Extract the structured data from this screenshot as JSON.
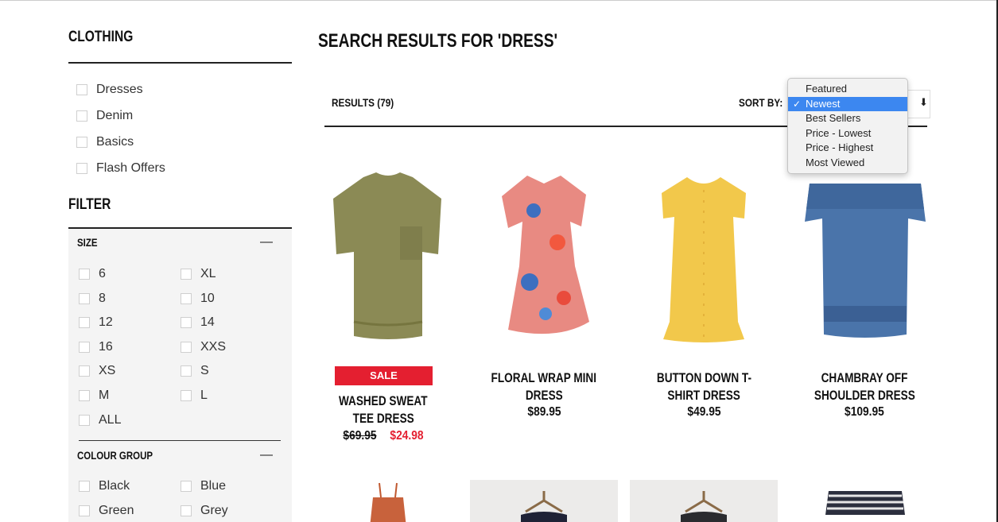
{
  "sidebar": {
    "clothing_heading": "CLOTHING",
    "categories": [
      {
        "label": "Dresses"
      },
      {
        "label": "Denim"
      },
      {
        "label": "Basics"
      },
      {
        "label": "Flash Offers"
      }
    ],
    "filter_heading": "FILTER",
    "size": {
      "title": "SIZE",
      "toggle": "—",
      "options": [
        "6",
        "XL",
        "8",
        "10",
        "12",
        "14",
        "16",
        "XXS",
        "XS",
        "S",
        "M",
        "L",
        "ALL"
      ]
    },
    "colour": {
      "title": "COLOUR GROUP",
      "toggle": "—",
      "options": [
        "Black",
        "Blue",
        "Green",
        "Grey"
      ]
    }
  },
  "main": {
    "title": "SEARCH RESULTS FOR 'DRESS'",
    "results_label": "RESULTS (79)",
    "sort_label": "SORT BY:",
    "sort_arrow": "⬇",
    "sort_options": [
      {
        "label": "Featured",
        "selected": false
      },
      {
        "label": "Newest",
        "selected": true
      },
      {
        "label": "Best Sellers",
        "selected": false
      },
      {
        "label": "Price - Lowest",
        "selected": false
      },
      {
        "label": "Price - Highest",
        "selected": false
      },
      {
        "label": "Most Viewed",
        "selected": false
      }
    ],
    "check_mark": "✓"
  },
  "products": [
    {
      "name_line1": "WASHED SWEAT",
      "name_line2": "TEE DRESS",
      "badge": "SALE",
      "old_price": "$69.95",
      "price": "$24.98",
      "color": "#8b8a55"
    },
    {
      "name_line1": "FLORAL WRAP MINI",
      "name_line2": "DRESS",
      "price": "$89.95",
      "color": "#e88a82"
    },
    {
      "name_line1": "BUTTON DOWN T-",
      "name_line2": "SHIRT DRESS",
      "price": "$49.95",
      "color": "#f2c84b"
    },
    {
      "name_line1": "CHAMBRAY OFF",
      "name_line2": "SHOULDER DRESS",
      "price": "$109.95",
      "color": "#4a74aa"
    }
  ],
  "colors": {
    "sale_red": "#e41f30",
    "select_blue": "#3c87f0",
    "filter_bg": "#f4f4f4"
  }
}
